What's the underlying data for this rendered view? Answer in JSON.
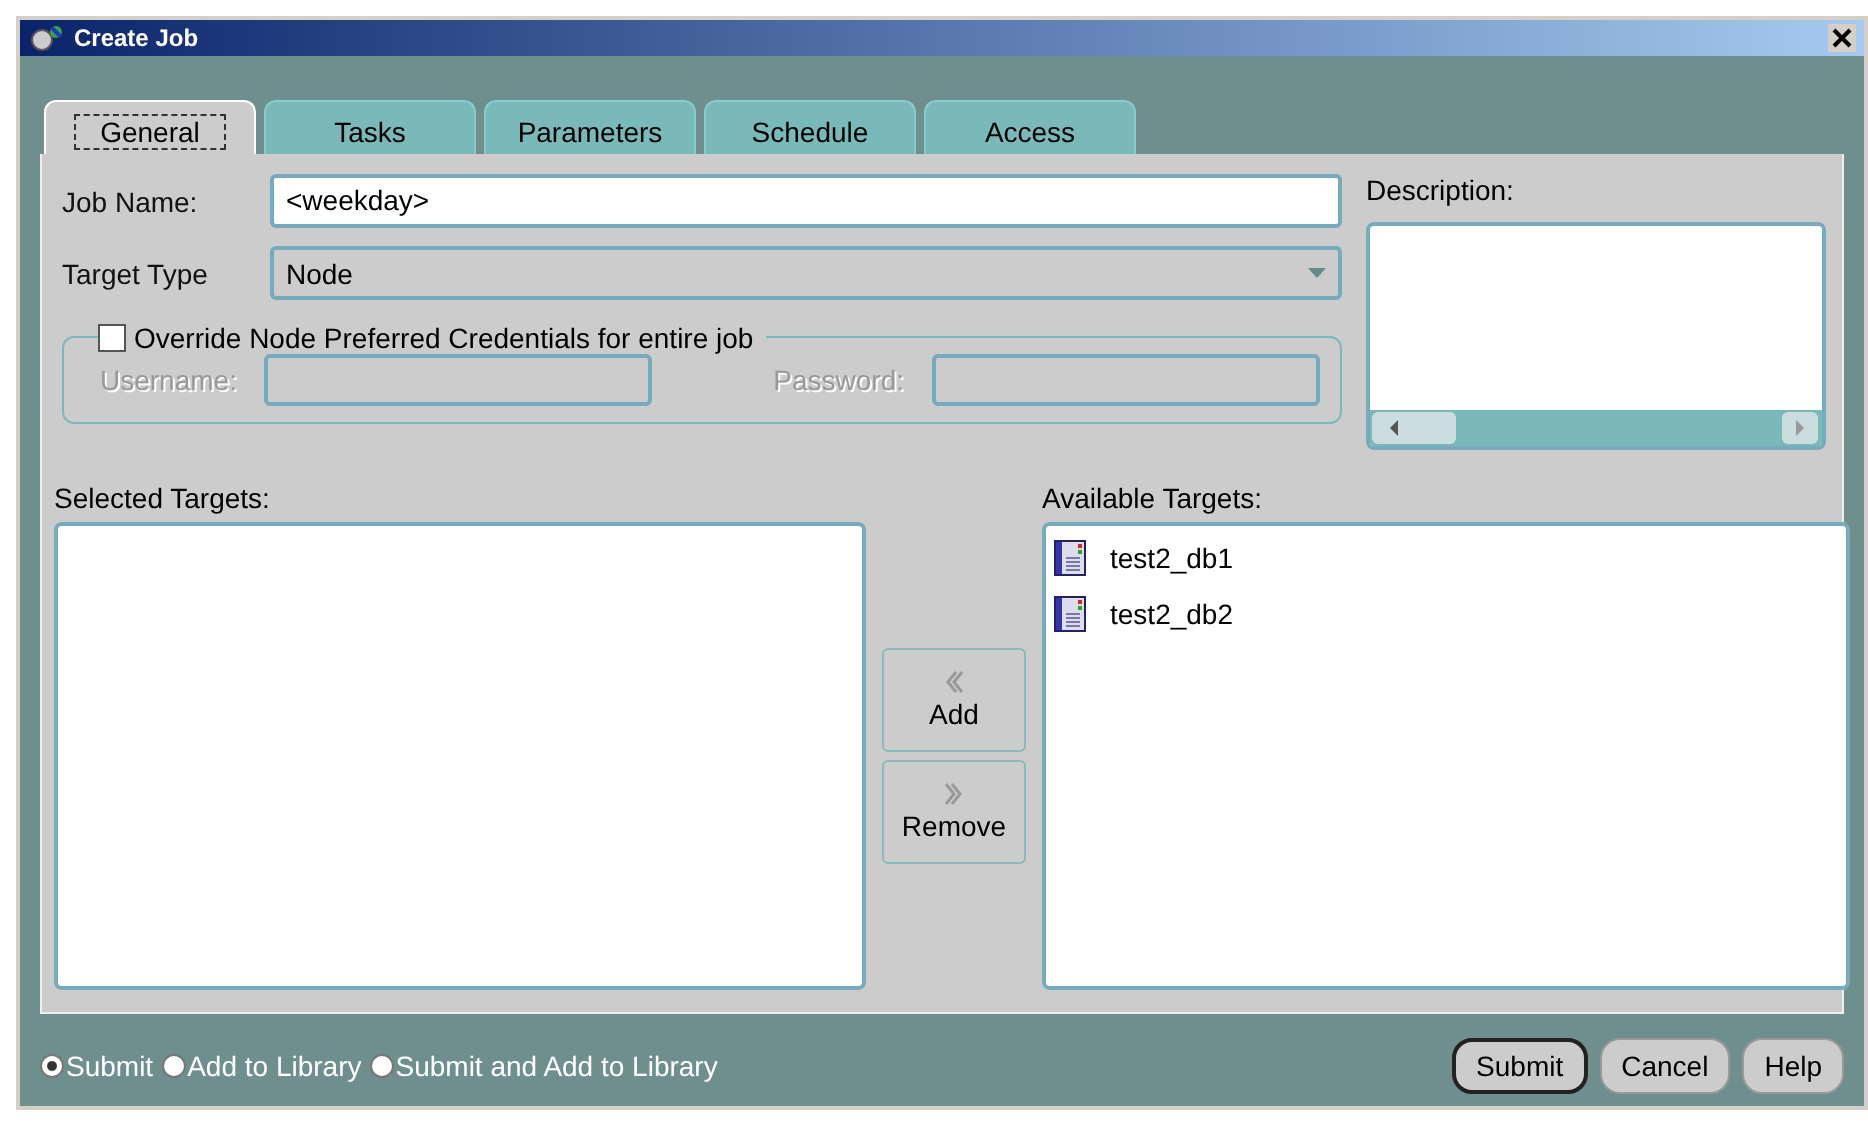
{
  "window": {
    "title": "Create Job"
  },
  "tabs": [
    {
      "label": "General",
      "selected": true
    },
    {
      "label": "Tasks",
      "selected": false
    },
    {
      "label": "Parameters",
      "selected": false
    },
    {
      "label": "Schedule",
      "selected": false
    },
    {
      "label": "Access",
      "selected": false
    }
  ],
  "job_name": {
    "label": "Job Name:",
    "value": "<weekday>"
  },
  "target_type": {
    "label": "Target Type",
    "value": "Node"
  },
  "credentials": {
    "label": "Override Node Preferred Credentials for entire job",
    "checked": false,
    "disabled": true,
    "username_label": "Username:",
    "password_label": "Password:"
  },
  "description": {
    "label": "Description:"
  },
  "selected_targets": {
    "label": "Selected Targets:"
  },
  "move_buttons": [
    {
      "label": "Add",
      "kind": "left"
    },
    {
      "label": "Remove",
      "kind": "right"
    }
  ],
  "available_targets": {
    "label": "Available Targets:",
    "items": [
      "test2_db1",
      "test2_db2"
    ]
  },
  "submit_options": [
    {
      "label": "Submit",
      "selected": true
    },
    {
      "label": "Add to Library",
      "selected": false
    },
    {
      "label": "Submit and Add to Library",
      "selected": false
    }
  ],
  "buttons": [
    {
      "label": "Submit",
      "default": true
    },
    {
      "label": "Cancel",
      "default": false
    },
    {
      "label": "Help",
      "default": false
    }
  ]
}
